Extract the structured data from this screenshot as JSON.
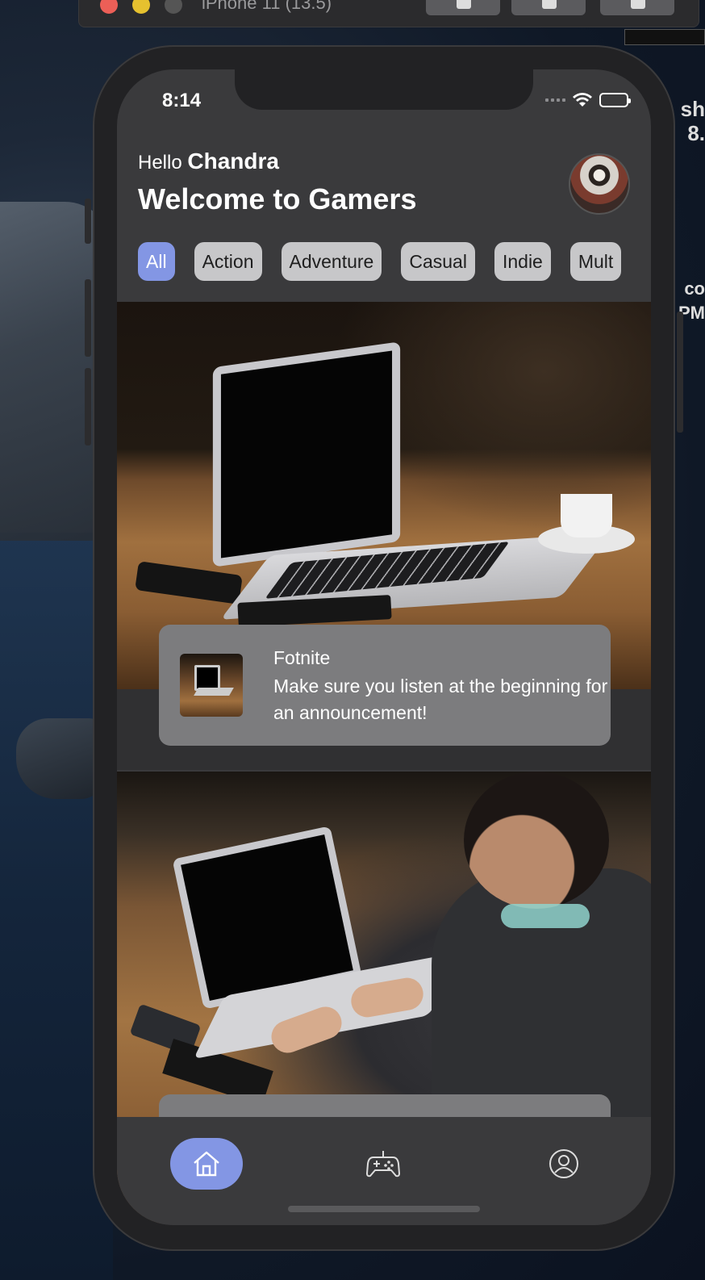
{
  "simulator": {
    "title": "iPhone 11 (13.5)"
  },
  "desktop": {
    "side_text_1": "sh",
    "side_text_2": "8.",
    "side_text_3": "co",
    "side_text_4": "PM"
  },
  "status_bar": {
    "time": "8:14"
  },
  "header": {
    "hello": "Hello",
    "user_name": "Chandra",
    "welcome": "Welcome to Gamers"
  },
  "categories": {
    "items": [
      "All",
      "Action",
      "Adventure",
      "Casual",
      "Indie",
      "Mult"
    ],
    "selected": "All"
  },
  "feed": [
    {
      "title": "Fotnite",
      "description": "Make sure you listen at the beginning for an announcement!"
    }
  ],
  "tabbar": {
    "items": [
      {
        "name": "home",
        "icon": "home-icon",
        "active": true
      },
      {
        "name": "games",
        "icon": "gamepad-icon",
        "active": false
      },
      {
        "name": "profile",
        "icon": "profile-icon",
        "active": false
      }
    ]
  },
  "colors": {
    "accent": "#8396e4",
    "screen_bg": "#3a3a3c",
    "card_bg": "#7c7c7e",
    "chip_bg": "#c7c7c9"
  }
}
